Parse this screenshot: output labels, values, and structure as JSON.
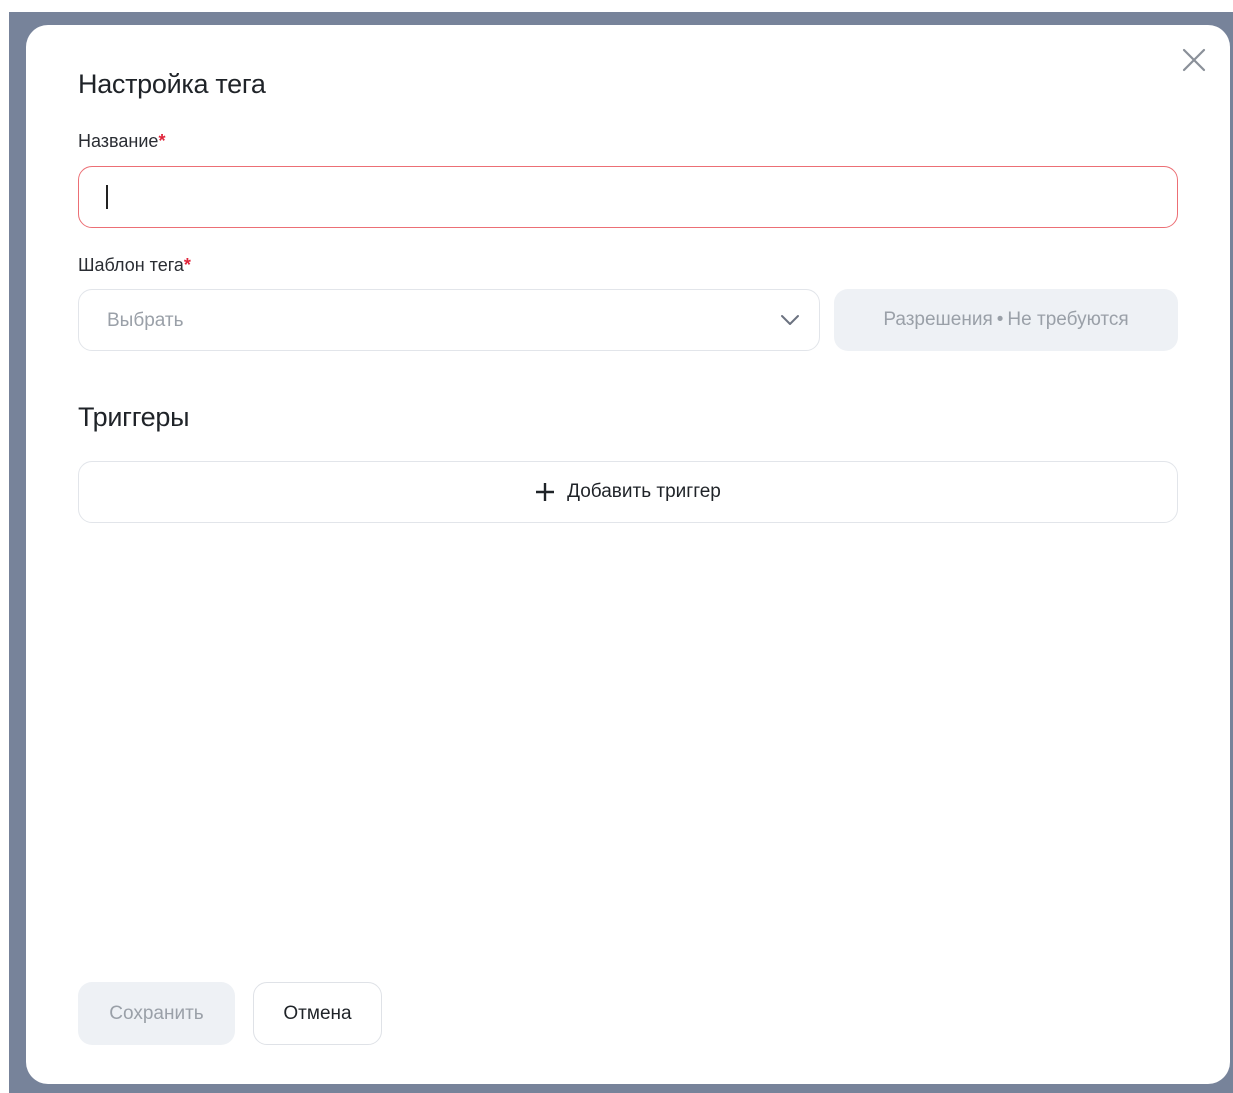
{
  "modal": {
    "title": "Настройка тега",
    "close_icon": "close-icon"
  },
  "fields": {
    "name": {
      "label": "Название",
      "required_mark": "*",
      "value": "",
      "state": "error"
    },
    "template": {
      "label": "Шаблон тега",
      "required_mark": "*",
      "placeholder": "Выбрать",
      "chevron_icon": "chevron-down-icon"
    },
    "permissions": {
      "label": "Разрешения",
      "separator": "•",
      "value": "Не требуются"
    }
  },
  "triggers": {
    "title": "Триггеры",
    "add_label": "Добавить триггер",
    "add_icon": "plus-icon"
  },
  "footer": {
    "save_label": "Сохранить",
    "cancel_label": "Отмена"
  },
  "colors": {
    "backdrop": "#77839a",
    "error_border": "#ec6f75",
    "required": "#e0243a",
    "disabled_bg": "#eef1f5",
    "disabled_text": "#9aa0a8"
  }
}
